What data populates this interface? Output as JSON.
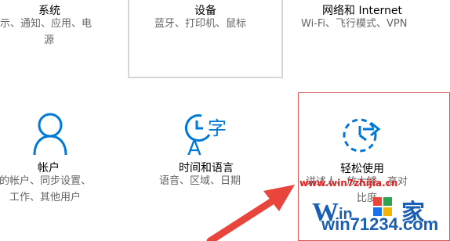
{
  "tiles": {
    "system": {
      "title": "系统",
      "desc_line1": "显示、通知、应用、电",
      "desc_line2": "源"
    },
    "devices": {
      "title": "设备",
      "desc_line1": "蓝牙、打印机、鼠标"
    },
    "network": {
      "title": "网络和 Internet",
      "desc_line1": "Wi-Fi、飞行模式、VPN"
    },
    "accounts": {
      "title": "帐户",
      "desc_line1": "你的帐户、同步设置、",
      "desc_line2": "工作、其他用户"
    },
    "time_language": {
      "title": "时间和语言",
      "desc_line1": "语音、区域、日期"
    },
    "ease_of_access": {
      "title": "轻松使用",
      "desc_line1": "讲述人、放大镜、高对",
      "desc_line2": "比度"
    }
  },
  "watermark": {
    "url": "www.win7zhijia.cn",
    "logo_text": "win71234.com"
  },
  "colors": {
    "accent": "#0078d7",
    "hover_border": "#d6d6d6",
    "highlight_border": "#d9534f",
    "arrow": "#e8453c",
    "watermark_red": "#e52222"
  },
  "icons": {
    "accounts": "person-icon",
    "time_language": "time-language-icon",
    "ease_of_access": "ease-of-access-icon"
  }
}
